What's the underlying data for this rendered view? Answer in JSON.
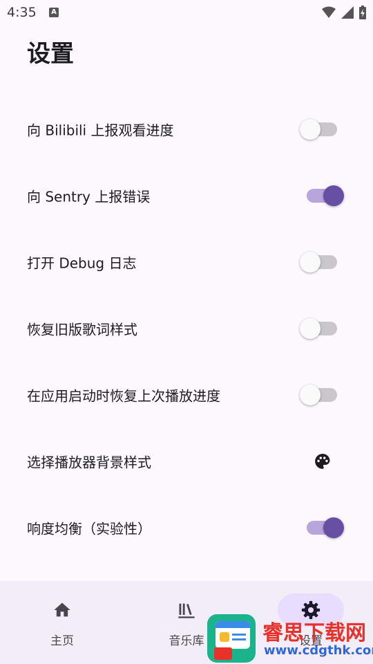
{
  "status_bar": {
    "time": "4:35",
    "badge": "A"
  },
  "page_title": "设置",
  "settings": [
    {
      "label": "向 Bilibili 上报观看进度",
      "control": "switch",
      "on": false
    },
    {
      "label": "向 Sentry 上报错误",
      "control": "switch",
      "on": true
    },
    {
      "label": "打开 Debug 日志",
      "control": "switch",
      "on": false
    },
    {
      "label": "恢复旧版歌词样式",
      "control": "switch",
      "on": false
    },
    {
      "label": "在应用启动时恢复上次播放进度",
      "control": "switch",
      "on": false
    },
    {
      "label": "选择播放器背景样式",
      "control": "palette-icon"
    },
    {
      "label": "响度均衡（实验性）",
      "control": "switch",
      "on": true
    }
  ],
  "bottom_nav": [
    {
      "label": "主页",
      "icon": "home-icon",
      "active": false
    },
    {
      "label": "音乐库",
      "icon": "library-icon",
      "active": false
    },
    {
      "label": "设置",
      "icon": "gear-icon",
      "active": true
    }
  ],
  "watermark": {
    "title": "睿思下载网",
    "url": "www.cdgthk.com"
  },
  "colors": {
    "accent": "#6750a4",
    "track_on": "#b6a6dc",
    "track_off": "#c9c6cd",
    "nav_bg": "#f3edf7",
    "nav_active": "#e9ddff",
    "background": "#fdf7fe"
  }
}
